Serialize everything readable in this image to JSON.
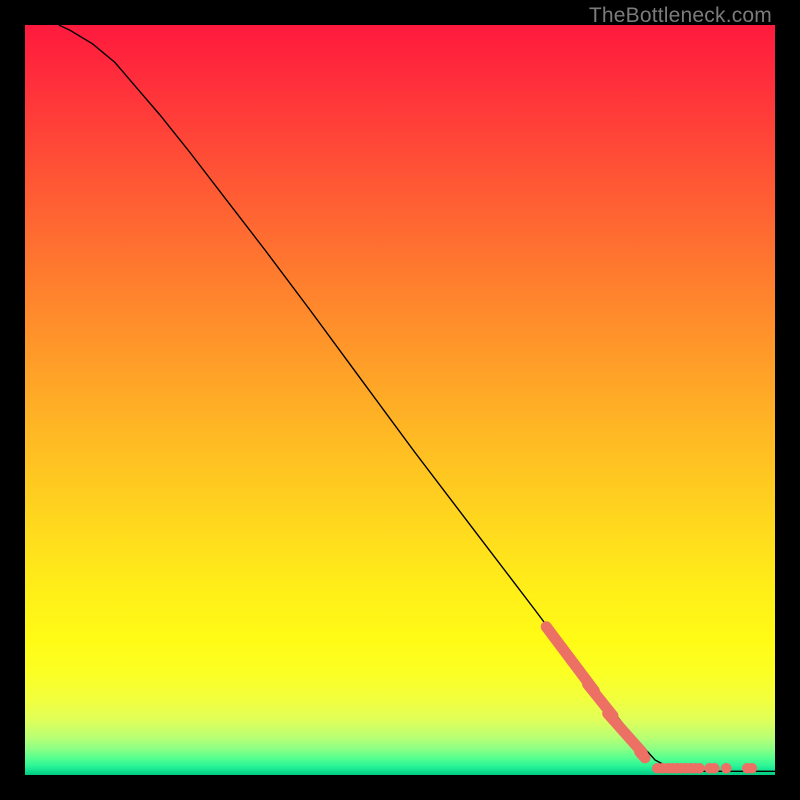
{
  "watermark": "TheBottleneck.com",
  "chart_data": {
    "type": "scatter",
    "title": "",
    "xlabel": "",
    "ylabel": "",
    "xlim": [
      0,
      100
    ],
    "ylim": [
      0,
      100
    ],
    "curve": {
      "comment": "black line roughly read from image, as (x_pct, y_pct) with 0,0 at bottom-left of plot area",
      "points": [
        [
          4.5,
          100
        ],
        [
          6,
          99.3
        ],
        [
          9,
          97.5
        ],
        [
          12,
          95
        ],
        [
          15,
          91.5
        ],
        [
          18,
          88
        ],
        [
          22,
          83
        ],
        [
          27,
          76.5
        ],
        [
          32,
          70
        ],
        [
          38,
          62
        ],
        [
          45,
          52.5
        ],
        [
          52,
          43
        ],
        [
          60,
          32.5
        ],
        [
          68,
          22
        ],
        [
          74,
          14
        ],
        [
          80,
          6.5
        ],
        [
          84,
          2
        ],
        [
          86.5,
          0.7
        ],
        [
          90,
          0.5
        ],
        [
          100,
          0.5
        ]
      ]
    },
    "marker_clusters": [
      {
        "cx": 72.7,
        "cy": 15.5,
        "len_along_line": 7.3,
        "color": "#ec7063"
      },
      {
        "cx": 76.7,
        "cy": 10.0,
        "len_along_line": 4.3,
        "color": "#ec7063"
      },
      {
        "cx": 80.0,
        "cy": 5.6,
        "len_along_line": 5.6,
        "color": "#ec7063"
      },
      {
        "cx": 82.3,
        "cy": 2.7,
        "len_along_line": 1.7,
        "color": "#ec7063"
      }
    ],
    "bottom_markers_x": [
      84.3,
      85.0,
      85.7,
      86.3,
      86.9,
      87.5,
      88.1,
      88.7,
      89.3,
      89.9,
      91.3,
      91.9,
      93.5,
      96.3,
      96.9
    ],
    "bottom_markers_y": 0.9,
    "bottom_marker_color": "#ec7063",
    "gradient_stops": [
      {
        "offset": 0.0,
        "color": "#ff1a3d"
      },
      {
        "offset": 0.06,
        "color": "#ff2a3c"
      },
      {
        "offset": 0.14,
        "color": "#ff4238"
      },
      {
        "offset": 0.22,
        "color": "#ff5a34"
      },
      {
        "offset": 0.3,
        "color": "#ff7230"
      },
      {
        "offset": 0.38,
        "color": "#ff892c"
      },
      {
        "offset": 0.46,
        "color": "#ffa028"
      },
      {
        "offset": 0.54,
        "color": "#ffb724"
      },
      {
        "offset": 0.62,
        "color": "#ffcc20"
      },
      {
        "offset": 0.7,
        "color": "#ffe11c"
      },
      {
        "offset": 0.76,
        "color": "#fff018"
      },
      {
        "offset": 0.82,
        "color": "#fffb16"
      },
      {
        "offset": 0.86,
        "color": "#fcff22"
      },
      {
        "offset": 0.895,
        "color": "#f3ff3a"
      },
      {
        "offset": 0.925,
        "color": "#e2ff58"
      },
      {
        "offset": 0.95,
        "color": "#b8ff74"
      },
      {
        "offset": 0.965,
        "color": "#8cff84"
      },
      {
        "offset": 0.978,
        "color": "#54ff90"
      },
      {
        "offset": 0.988,
        "color": "#2bf496"
      },
      {
        "offset": 0.994,
        "color": "#12e28f"
      },
      {
        "offset": 1.0,
        "color": "#00c97f"
      }
    ]
  }
}
